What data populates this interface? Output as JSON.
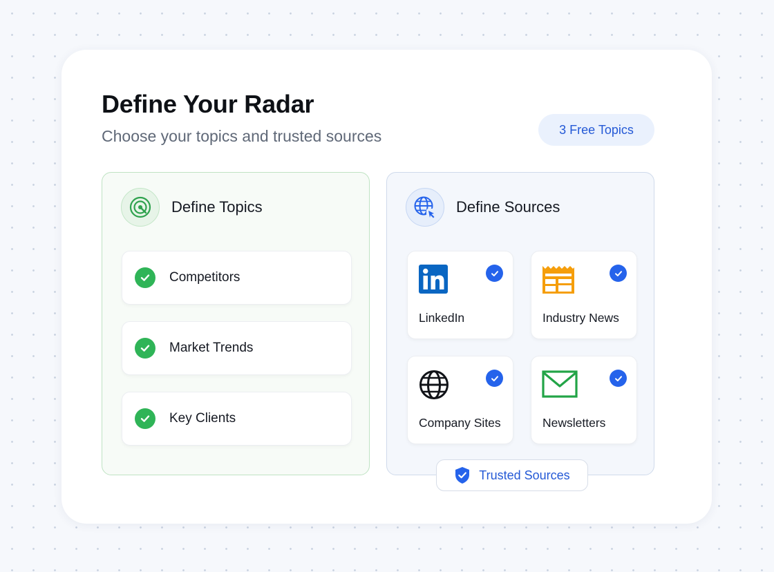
{
  "header": {
    "title": "Define Your Radar",
    "subtitle": "Choose your topics and trusted sources",
    "badge": "3 Free Topics"
  },
  "topics_panel": {
    "title": "Define Topics",
    "icon": "radar-icon",
    "items": [
      {
        "label": "Competitors",
        "checked": true
      },
      {
        "label": "Market Trends",
        "checked": true
      },
      {
        "label": "Key Clients",
        "checked": true
      }
    ]
  },
  "sources_panel": {
    "title": "Define Sources",
    "icon": "globe-cursor-icon",
    "items": [
      {
        "label": "LinkedIn",
        "icon": "linkedin-icon",
        "checked": true
      },
      {
        "label": "Industry News",
        "icon": "newspaper-icon",
        "checked": true
      },
      {
        "label": "Company Sites",
        "icon": "globe-icon",
        "checked": true
      },
      {
        "label": "Newsletters",
        "icon": "envelope-icon",
        "checked": true
      }
    ],
    "trusted_label": "Trusted Sources"
  },
  "colors": {
    "accent_blue": "#2563eb",
    "check_green": "#2fb457",
    "linkedin_blue": "#0a66c2",
    "news_orange": "#f59e0b",
    "mail_green": "#22a447"
  }
}
